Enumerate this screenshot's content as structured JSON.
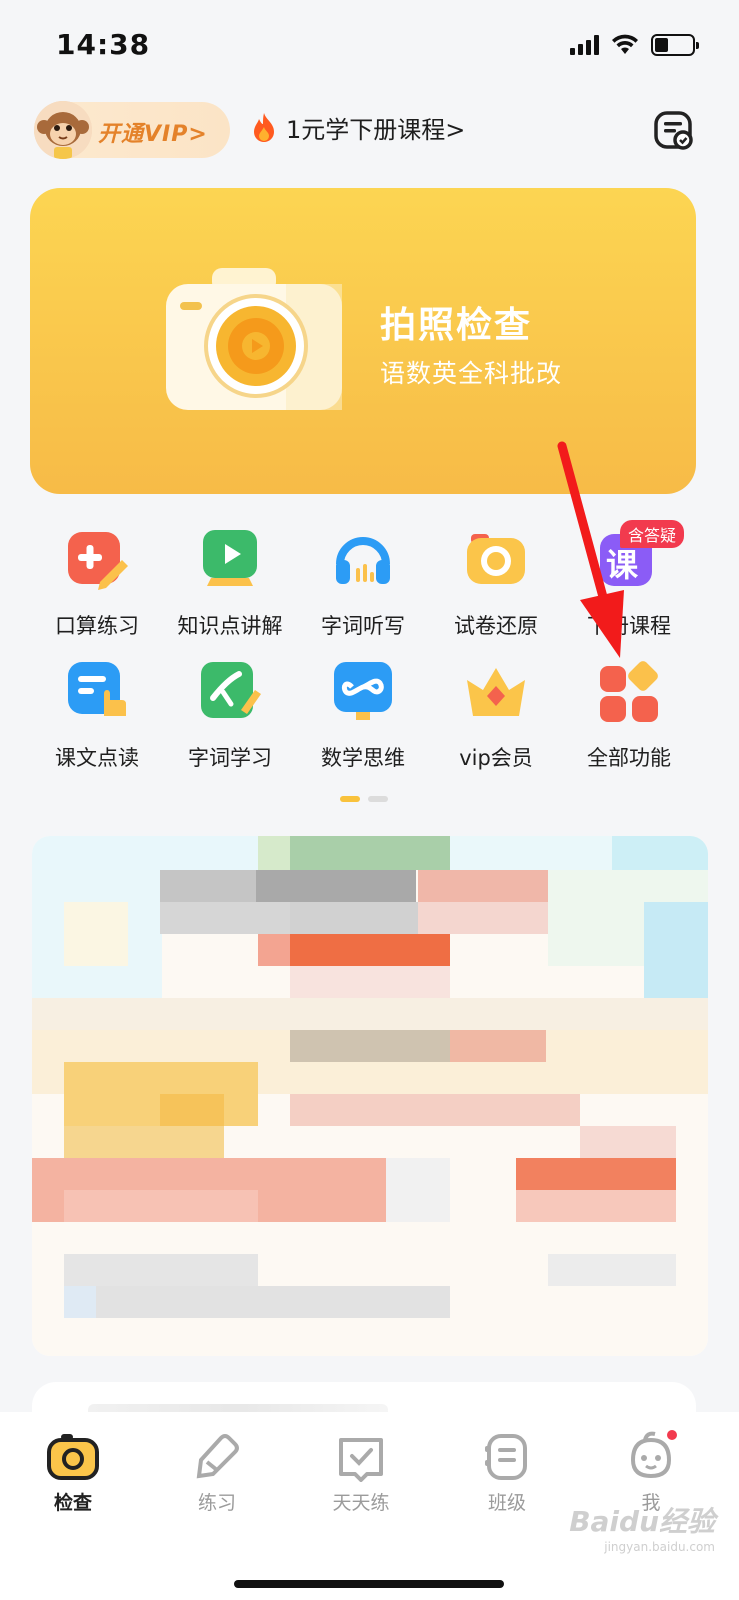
{
  "status_bar": {
    "time": "14:38"
  },
  "header": {
    "vip_label": "开通VIP>",
    "promo_text": "1元学下册课程>"
  },
  "hero": {
    "title": "拍照检查",
    "subtitle": "语数英全科批改"
  },
  "functions": [
    {
      "label": "口算练习",
      "icon": "oral-math-icon"
    },
    {
      "label": "知识点讲解",
      "icon": "video-lesson-icon"
    },
    {
      "label": "字词听写",
      "icon": "headphones-icon"
    },
    {
      "label": "试卷还原",
      "icon": "camera-icon"
    },
    {
      "label": "下册课程",
      "icon": "course-icon",
      "badge": "含答疑",
      "badge_glyph": "课"
    },
    {
      "label": "课文点读",
      "icon": "point-read-icon"
    },
    {
      "label": "字词学习",
      "icon": "word-study-icon"
    },
    {
      "label": "数学思维",
      "icon": "math-thinking-icon"
    },
    {
      "label": "vip会员",
      "icon": "crown-icon"
    },
    {
      "label": "全部功能",
      "icon": "all-functions-icon"
    }
  ],
  "tabs": [
    {
      "label": "检查",
      "icon": "camera-tab-icon",
      "active": true
    },
    {
      "label": "练习",
      "icon": "pen-tab-icon",
      "active": false
    },
    {
      "label": "天天练",
      "icon": "daily-check-icon",
      "active": false
    },
    {
      "label": "班级",
      "icon": "class-icon",
      "active": false
    },
    {
      "label": "我",
      "icon": "profile-icon",
      "active": false,
      "badge_dot": true
    }
  ],
  "watermark": {
    "text": "Baidu经验",
    "sub": "jingyan.baidu.com"
  },
  "colors": {
    "hero_gradient_top": "#fcd552",
    "hero_gradient_bottom": "#f7bb47",
    "vip_text": "#e4822a",
    "arrow": "#f21b1b",
    "badge": "#f23a4e"
  }
}
